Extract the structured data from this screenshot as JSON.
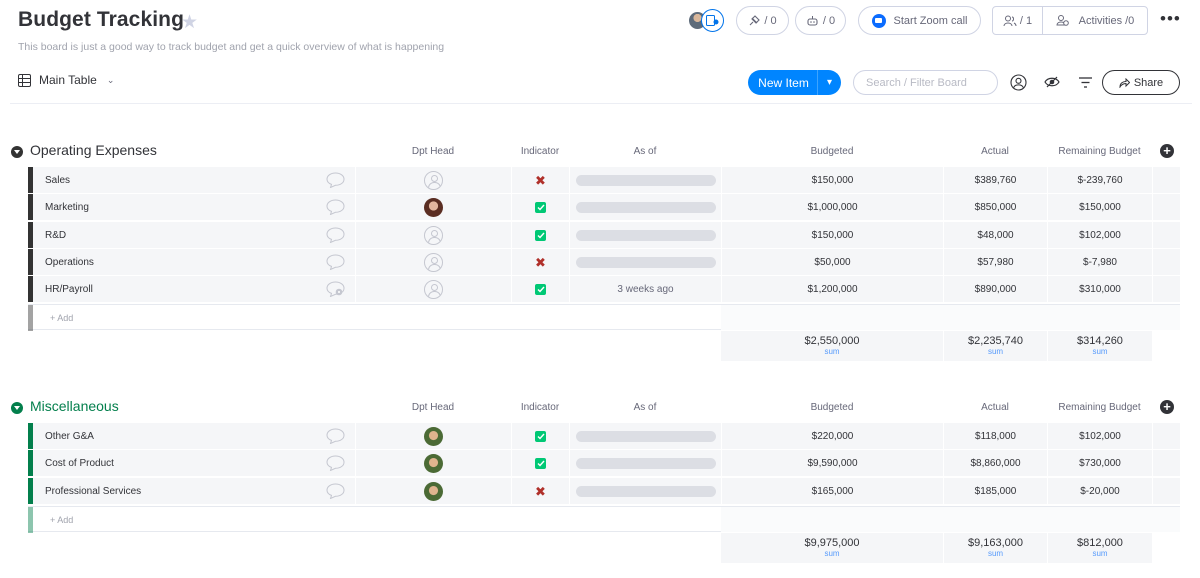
{
  "board": {
    "title": "Budget Tracking",
    "description": "This board is just a good way to track budget and get a quick overview of what is happening"
  },
  "header": {
    "integrations_count": "/ 0",
    "automations_count": "/ 0",
    "zoom_label": "Start Zoom call",
    "members_count": "/ 1",
    "activities_label": "Activities /0"
  },
  "toolbar": {
    "view_label": "Main Table",
    "new_item_label": "New Item",
    "search_placeholder": "Search / Filter Board",
    "share_label": "Share"
  },
  "columns": {
    "dpt_head": "Dpt Head",
    "indicator": "Indicator",
    "as_of": "As of",
    "budgeted": "Budgeted",
    "actual": "Actual",
    "remaining": "Remaining Budget"
  },
  "colors": {
    "group1": "#333333",
    "group2": "#037f4c",
    "accent": "#0085ff",
    "status_done": "#00c875",
    "status_stuck": "#b0302a"
  },
  "groups": [
    {
      "title": "Operating Expenses",
      "add_label": "+ Add",
      "rows": [
        {
          "name": "Sales",
          "person": "empty",
          "indicator": "x",
          "as_of": "",
          "budgeted": "$150,000",
          "actual": "$389,760",
          "remaining": "$-239,760"
        },
        {
          "name": "Marketing",
          "person": "photo-f",
          "indicator": "check",
          "as_of": "",
          "budgeted": "$1,000,000",
          "actual": "$850,000",
          "remaining": "$150,000"
        },
        {
          "name": "R&D",
          "person": "empty",
          "indicator": "check",
          "as_of": "",
          "budgeted": "$150,000",
          "actual": "$48,000",
          "remaining": "$102,000"
        },
        {
          "name": "Operations",
          "person": "empty",
          "indicator": "x",
          "as_of": "",
          "budgeted": "$50,000",
          "actual": "$57,980",
          "remaining": "$-7,980"
        },
        {
          "name": "HR/Payroll",
          "person": "empty",
          "indicator": "check",
          "as_of": "3 weeks ago",
          "budgeted": "$1,200,000",
          "actual": "$890,000",
          "remaining": "$310,000"
        }
      ],
      "sums": {
        "budgeted": "$2,550,000",
        "actual": "$2,235,740",
        "remaining": "$314,260",
        "label": "sum"
      }
    },
    {
      "title": "Miscellaneous",
      "add_label": "+ Add",
      "rows": [
        {
          "name": "Other G&A",
          "person": "photo-m",
          "indicator": "check",
          "as_of": "",
          "budgeted": "$220,000",
          "actual": "$118,000",
          "remaining": "$102,000"
        },
        {
          "name": "Cost of Product",
          "person": "photo-m",
          "indicator": "check",
          "as_of": "",
          "budgeted": "$9,590,000",
          "actual": "$8,860,000",
          "remaining": "$730,000"
        },
        {
          "name": "Professional Services",
          "person": "photo-m",
          "indicator": "x",
          "as_of": "",
          "budgeted": "$165,000",
          "actual": "$185,000",
          "remaining": "$-20,000"
        }
      ],
      "sums": {
        "budgeted": "$9,975,000",
        "actual": "$9,163,000",
        "remaining": "$812,000",
        "label": "sum"
      }
    }
  ]
}
